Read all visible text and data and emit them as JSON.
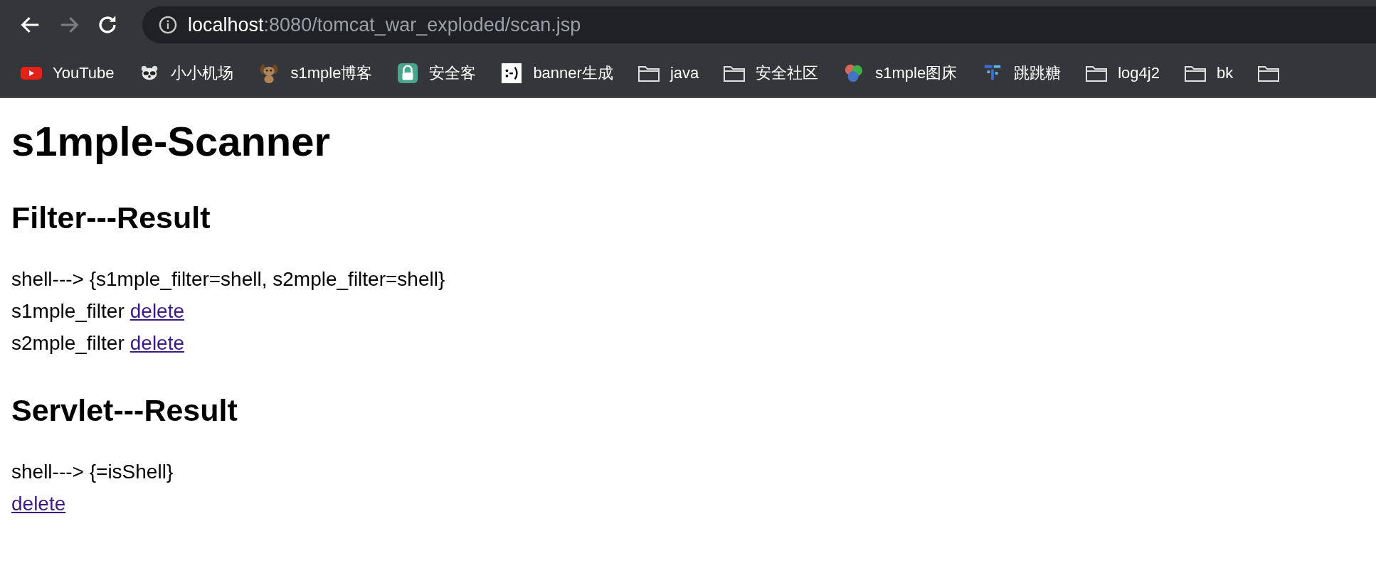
{
  "toolbar": {
    "url_host": "localhost",
    "url_rest": ":8080/tomcat_war_exploded/scan.jsp",
    "forward_disabled": true
  },
  "bookmarks": [
    {
      "kind": "youtube",
      "label": "YouTube"
    },
    {
      "kind": "raccoon",
      "label": "小小机场"
    },
    {
      "kind": "dog",
      "label": "s1mple博客"
    },
    {
      "kind": "lock",
      "label": "安全客"
    },
    {
      "kind": "smiley",
      "label": "banner生成"
    },
    {
      "kind": "folder",
      "label": "java"
    },
    {
      "kind": "folder",
      "label": "安全社区"
    },
    {
      "kind": "circles",
      "label": "s1mple图床"
    },
    {
      "kind": "blocks",
      "label": "跳跳糖"
    },
    {
      "kind": "folder",
      "label": "log4j2"
    },
    {
      "kind": "folder",
      "label": "bk"
    },
    {
      "kind": "folder"
    }
  ],
  "page": {
    "title": "s1mple-Scanner",
    "sections": [
      {
        "heading": "Filter---Result",
        "lines": [
          {
            "text": "shell---> {s1mple_filter=shell, s2mple_filter=shell}"
          },
          {
            "text": "s1mple_filter",
            "link": "delete"
          },
          {
            "text": "s2mple_filter",
            "link": "delete"
          }
        ]
      },
      {
        "heading": "Servlet---Result",
        "lines": [
          {
            "text": "shell---> {=isShell}"
          },
          {
            "link": "delete"
          }
        ]
      }
    ]
  }
}
